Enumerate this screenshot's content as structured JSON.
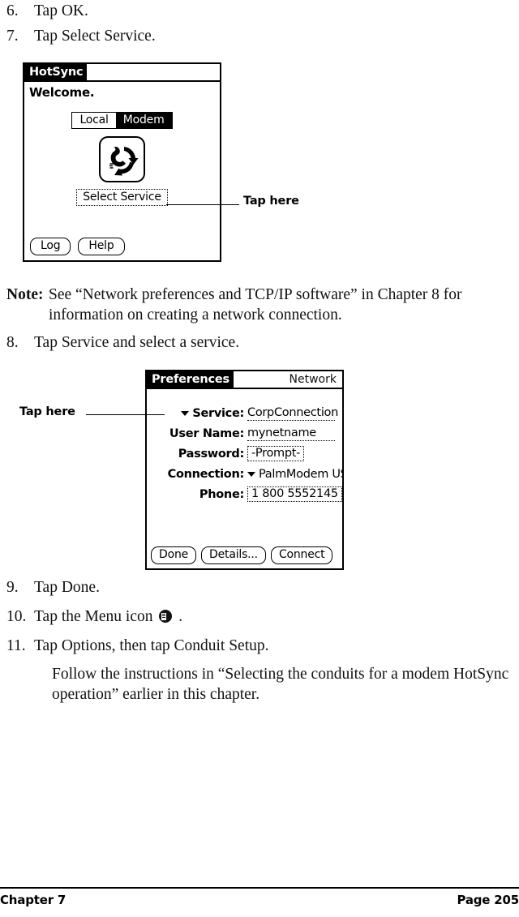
{
  "steps": {
    "step6": {
      "num": "6.",
      "text": "Tap OK."
    },
    "step7": {
      "num": "7.",
      "text": "Tap Select Service."
    },
    "step8": {
      "num": "8.",
      "text": "Tap Service and select a service."
    },
    "step9": {
      "num": "9.",
      "text": "Tap Done."
    },
    "step10": {
      "num": "10.",
      "text_before": "Tap the Menu icon",
      "icon": "menu-icon",
      "text_after": "."
    },
    "step11": {
      "num": "11.",
      "text": "Tap Options, then tap Conduit Setup."
    }
  },
  "note": {
    "label": "Note:",
    "text": "See “Network preferences and TCP/IP software” in Chapter 8 for information on creating a network connection."
  },
  "follow_paragraph": "Follow the instructions in “Selecting the conduits for a modem HotSync operation” earlier in this chapter.",
  "hotsync_screen": {
    "title": "HotSync",
    "welcome": "Welcome.",
    "toggle": {
      "options": [
        "Local",
        "Modem"
      ],
      "selected": "Modem"
    },
    "icon": "hotsync-modem-icon",
    "select_service_button": "Select Service",
    "footer_buttons": [
      "Log",
      "Help"
    ]
  },
  "prefs_screen": {
    "title": "Preferences",
    "category": "Network",
    "fields": [
      {
        "label": "Service:",
        "value": "CorpConnection",
        "style": "underline",
        "has_caret": true
      },
      {
        "label": "User Name:",
        "value": "mynetname",
        "style": "underline",
        "has_caret": false
      },
      {
        "label": "Password:",
        "value": "-Prompt-",
        "style": "boxed",
        "has_caret": false
      },
      {
        "label": "Connection:",
        "value": "PalmModem US/C...",
        "style": "plain",
        "has_caret": true
      },
      {
        "label": "Phone:",
        "value": "1 800 5552145",
        "style": "boxed",
        "has_caret": false
      }
    ],
    "footer_buttons": [
      "Done",
      "Details...",
      "Connect"
    ]
  },
  "callouts": {
    "hotsync_tap_here": "Tap here",
    "prefs_tap_here": "Tap here"
  },
  "footer": {
    "chapter": "Chapter 7",
    "page": "Page 205"
  },
  "colors": {
    "ink": "#000000",
    "paper": "#ffffff"
  }
}
